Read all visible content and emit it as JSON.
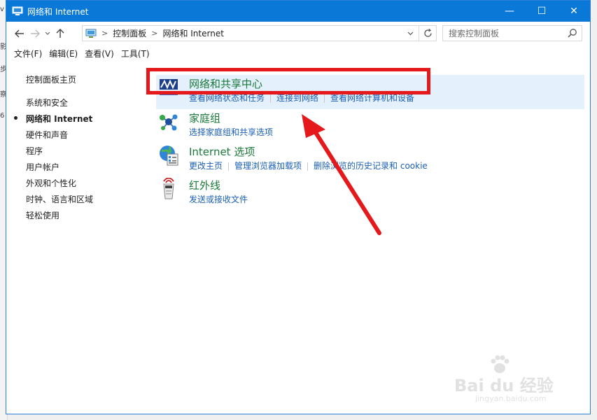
{
  "window": {
    "title": "网络和 Internet"
  },
  "window_buttons": {
    "minimize": "—",
    "maximize": "☐",
    "close": "✕"
  },
  "left_strip": {
    "chars": [
      "v",
      "影",
      "步",
      "察",
      "6"
    ]
  },
  "address": {
    "breadcrumbs": [
      "控制面板",
      "网络和 Internet"
    ],
    "search_placeholder": "搜索控制面板"
  },
  "menu": [
    "文件(F)",
    "编辑(E)",
    "查看(V)",
    "工具(T)"
  ],
  "sidebar": {
    "home": "控制面板主页",
    "items": [
      {
        "label": "系统和安全",
        "active": false
      },
      {
        "label": "网络和 Internet",
        "active": true
      },
      {
        "label": "硬件和声音",
        "active": false
      },
      {
        "label": "程序",
        "active": false
      },
      {
        "label": "用户帐户",
        "active": false
      },
      {
        "label": "外观和个性化",
        "active": false
      },
      {
        "label": "时钟、语言和区域",
        "active": false
      },
      {
        "label": "轻松使用",
        "active": false
      }
    ]
  },
  "categories": [
    {
      "title": "网络和共享中心",
      "icon": "network-sharing-icon",
      "links": [
        "查看网络状态和任务",
        "连接到网络",
        "查看网络计算机和设备"
      ]
    },
    {
      "title": "家庭组",
      "icon": "homegroup-icon",
      "links": [
        "选择家庭组和共享选项"
      ]
    },
    {
      "title": "Internet 选项",
      "icon": "internet-options-icon",
      "links": [
        "更改主页",
        "管理浏览器加载项",
        "删除浏览的历史记录和 cookie"
      ]
    },
    {
      "title": "红外线",
      "icon": "infrared-icon",
      "links": [
        "发送或接收文件"
      ]
    }
  ],
  "watermark": {
    "brand": "Bai du 经验",
    "url": "jingyan.baidu.com"
  },
  "colors": {
    "titlebar": "#0a78d7",
    "category_title": "#1a7a3a",
    "link": "#1a5fb4",
    "highlight": "#e4f0fb",
    "annotation_red": "#e5181b"
  }
}
